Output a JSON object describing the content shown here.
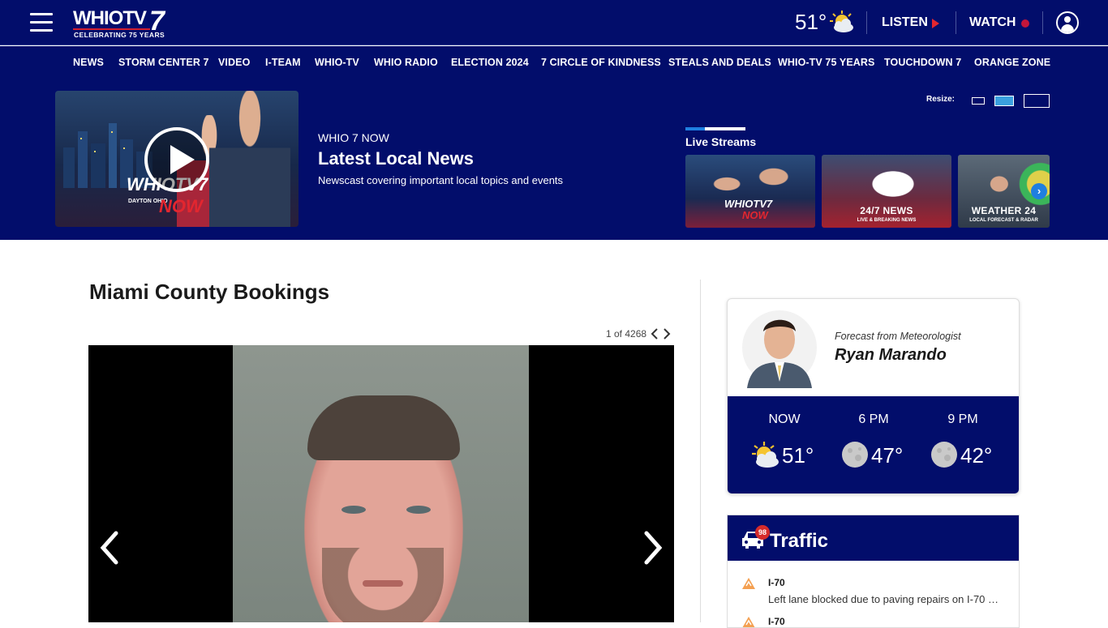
{
  "header": {
    "logo_text": "WHIOTV",
    "logo_number": "7",
    "logo_tagline": "CELEBRATING 75 YEARS",
    "temperature": "51°",
    "weather_icon": "partly-sunny-icon",
    "listen_label": "LISTEN",
    "watch_label": "WATCH",
    "accent_red": "#e3262f",
    "brand_navy": "#020d6b"
  },
  "nav": {
    "items": [
      "NEWS",
      "STORM CENTER 7",
      "VIDEO",
      "I-TEAM",
      "WHIO-TV",
      "WHIO RADIO",
      "ELECTION 2024",
      "7 CIRCLE OF KINDNESS",
      "STEALS AND DEALS",
      "WHIO-TV 75 YEARS",
      "TOUCHDOWN 7",
      "ORANGE ZONE"
    ]
  },
  "video": {
    "kicker": "WHIO 7 NOW",
    "title": "Latest Local News",
    "description": "Newscast covering important local topics and events",
    "thumb_logo": "WHIOTV7",
    "thumb_now": "NOW",
    "thumb_city": "DAYTON OHIO",
    "resize_label": "Resize:",
    "live_streams_title": "Live Streams",
    "streams": [
      {
        "label": "",
        "sub": "",
        "logo": "WHIOTV7",
        "logo_now": "NOW"
      },
      {
        "label": "24/7 NEWS",
        "sub": "LIVE & BREAKING NEWS"
      },
      {
        "label": "WEATHER 24",
        "sub": "LOCAL FORECAST & RADAR"
      }
    ]
  },
  "main": {
    "title": "Miami County Bookings",
    "counter": "1 of 4268"
  },
  "weather": {
    "from_label": "Forecast from Meteorologist",
    "meteorologist": "Ryan Marando",
    "periods": [
      {
        "time": "NOW",
        "temp": "51°",
        "icon": "partly-sunny-icon"
      },
      {
        "time": "6 PM",
        "temp": "47°",
        "icon": "moon-icon"
      },
      {
        "time": "9 PM",
        "temp": "42°",
        "icon": "moon-icon"
      }
    ]
  },
  "traffic": {
    "title": "Traffic",
    "badge_count": "98",
    "items": [
      {
        "road": "I-70",
        "desc": "Left lane blocked due to paving repairs on I-70 …"
      },
      {
        "road": "I-70",
        "desc": ""
      }
    ]
  }
}
